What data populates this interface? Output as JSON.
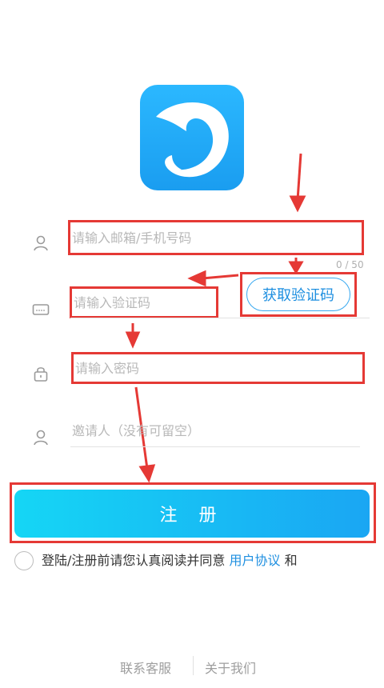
{
  "form": {
    "account_placeholder": "请输入邮箱/手机号码",
    "account_counter": "0 / 50",
    "code_placeholder": "请输入验证码",
    "get_code_label": "获取验证码",
    "password_placeholder": "请输入密码",
    "invite_placeholder": "邀请人（没有可留空）"
  },
  "register_button": "注 册",
  "agreement": {
    "prefix": "登陆/注册前请您认真阅读并同意 ",
    "link": "用户协议",
    "suffix": " 和"
  },
  "footer": {
    "contact": "联系客服",
    "about": "关于我们"
  },
  "colors": {
    "accent": "#1e8fe0",
    "button_gradient_start": "#15d6f5",
    "button_gradient_end": "#1aa6f3",
    "annotation_red": "#e53935"
  },
  "icons": {
    "app_logo": "dolphin-logo-icon",
    "account": "user-icon",
    "code": "keyboard-icon",
    "password": "lock-icon",
    "invite": "user-icon"
  }
}
